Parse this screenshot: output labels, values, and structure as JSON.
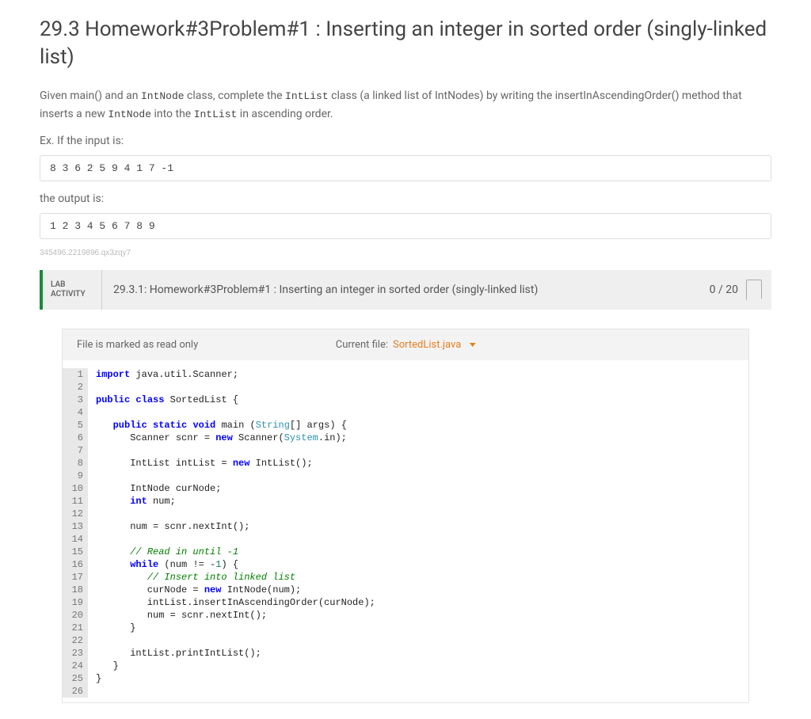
{
  "header": {
    "title": "29.3 Homework#3Problem#1 : Inserting an integer in sorted order (singly-linked list)"
  },
  "description": {
    "pre_text": "Given main() and an ",
    "code1": "IntNode",
    "mid_text1": " class, complete the ",
    "code2": "IntList",
    "mid_text2": " class (a linked list of IntNodes) by writing the insertInAscendingOrder() method that inserts a new ",
    "code3": "IntNode",
    "mid_text3": " into the ",
    "code4": "IntList",
    "end_text": " in ascending order."
  },
  "example": {
    "input_label": "Ex. If the input is:",
    "input_value": "8 3 6 2 5 9 4 1 7 -1",
    "output_label": "the output is:",
    "output_value": "1 2 3 4 5 6 7 8 9"
  },
  "watermark": "345496.2219896.qx3zqy7",
  "activity": {
    "label_top": "LAB",
    "label_bottom": "ACTIVITY",
    "title": "29.3.1: Homework#3Problem#1 : Inserting an integer in sorted order (singly-linked list)",
    "score": "0 / 20"
  },
  "editor": {
    "readonly_label": "File is marked as read only",
    "current_file_label": "Current file:",
    "filename": "SortedList.java",
    "line_count": 26
  },
  "code_tokens": [
    [
      {
        "t": "import",
        "c": "kw"
      },
      {
        "t": " java.util.Scanner;",
        "c": ""
      }
    ],
    [],
    [
      {
        "t": "public",
        "c": "kw"
      },
      {
        "t": " ",
        "c": ""
      },
      {
        "t": "class",
        "c": "kw"
      },
      {
        "t": " SortedList {",
        "c": ""
      }
    ],
    [],
    [
      {
        "t": "   ",
        "c": ""
      },
      {
        "t": "public",
        "c": "kw"
      },
      {
        "t": " ",
        "c": ""
      },
      {
        "t": "static",
        "c": "kw"
      },
      {
        "t": " ",
        "c": ""
      },
      {
        "t": "void",
        "c": "keytype"
      },
      {
        "t": " main (",
        "c": ""
      },
      {
        "t": "String",
        "c": "type"
      },
      {
        "t": "[] args) {",
        "c": ""
      }
    ],
    [
      {
        "t": "      Scanner scnr = ",
        "c": ""
      },
      {
        "t": "new",
        "c": "kw"
      },
      {
        "t": " Scanner(",
        "c": ""
      },
      {
        "t": "System",
        "c": "type"
      },
      {
        "t": ".in);",
        "c": ""
      }
    ],
    [],
    [
      {
        "t": "      IntList intList = ",
        "c": ""
      },
      {
        "t": "new",
        "c": "kw"
      },
      {
        "t": " IntList();",
        "c": ""
      }
    ],
    [],
    [
      {
        "t": "      IntNode curNode;",
        "c": ""
      }
    ],
    [
      {
        "t": "      ",
        "c": ""
      },
      {
        "t": "int",
        "c": "keytype"
      },
      {
        "t": " num;",
        "c": ""
      }
    ],
    [],
    [
      {
        "t": "      num = scnr.nextInt();",
        "c": ""
      }
    ],
    [],
    [
      {
        "t": "      ",
        "c": ""
      },
      {
        "t": "// Read in until -1",
        "c": "cmt"
      }
    ],
    [
      {
        "t": "      ",
        "c": ""
      },
      {
        "t": "while",
        "c": "kw"
      },
      {
        "t": " (num != -",
        "c": ""
      },
      {
        "t": "1",
        "c": "num"
      },
      {
        "t": ") {",
        "c": ""
      }
    ],
    [
      {
        "t": "         ",
        "c": ""
      },
      {
        "t": "// Insert into linked list",
        "c": "cmt"
      }
    ],
    [
      {
        "t": "         curNode = ",
        "c": ""
      },
      {
        "t": "new",
        "c": "kw"
      },
      {
        "t": " IntNode(num);",
        "c": ""
      }
    ],
    [
      {
        "t": "         intList.insertInAscendingOrder(curNode);",
        "c": ""
      }
    ],
    [
      {
        "t": "         num = scnr.nextInt();",
        "c": ""
      }
    ],
    [
      {
        "t": "      }",
        "c": ""
      }
    ],
    [],
    [
      {
        "t": "      intList.printIntList();",
        "c": ""
      }
    ],
    [
      {
        "t": "   }",
        "c": ""
      }
    ],
    [
      {
        "t": "}",
        "c": ""
      }
    ],
    []
  ]
}
